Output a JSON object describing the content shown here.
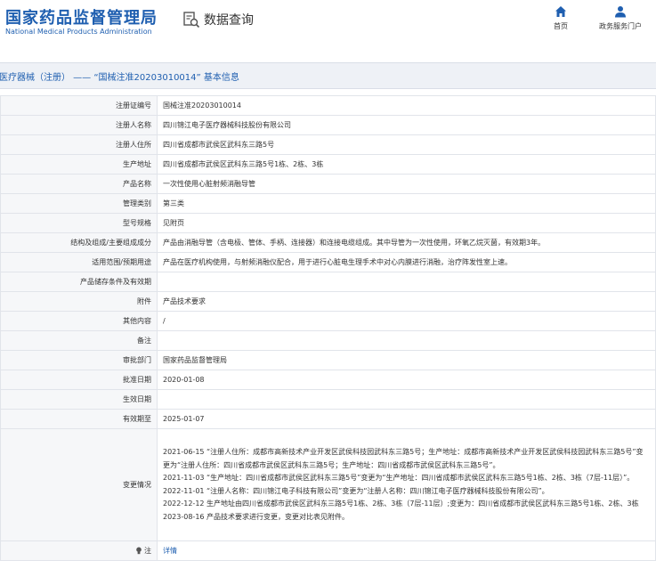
{
  "header": {
    "logo_cn": "国家药品监督管理局",
    "logo_en": "National Medical Products Administration",
    "data_query": "数据查询",
    "nav": [
      {
        "label": "首页",
        "icon": "home-icon"
      },
      {
        "label": "政务服务门户",
        "icon": "user-icon"
      }
    ]
  },
  "title": "医疗器械（注册） —— “国械注准20203010014” 基本信息",
  "rows": [
    {
      "label": "注册证编号",
      "value": "国械注准20203010014"
    },
    {
      "label": "注册人名称",
      "value": "四川锦江电子医疗器械科技股份有限公司"
    },
    {
      "label": "注册人住所",
      "value": "四川省成都市武侯区武科东三路5号"
    },
    {
      "label": "生产地址",
      "value": "四川省成都市武侯区武科东三路5号1栋、2栋、3栋"
    },
    {
      "label": "产品名称",
      "value": "一次性使用心脏射频消融导管"
    },
    {
      "label": "管理类别",
      "value": "第三类"
    },
    {
      "label": "型号规格",
      "value": "见附页"
    },
    {
      "label": "结构及组成/主要组成成分",
      "value": "产品由消融导管（含电极、管体、手柄、连接器）和连接电缆组成。其中导管为一次性使用，环氧乙烷灭菌，有效期3年。"
    },
    {
      "label": "适用范围/预期用途",
      "value": "产品在医疗机构使用，与射频消融仪配合，用于进行心脏电生理手术中对心内膜进行消融，治疗阵发性室上速。"
    },
    {
      "label": "产品储存条件及有效期",
      "value": ""
    },
    {
      "label": "附件",
      "value": "产品技术要求"
    },
    {
      "label": "其他内容",
      "value": "/"
    },
    {
      "label": "备注",
      "value": ""
    },
    {
      "label": "审批部门",
      "value": "国家药品监督管理局"
    },
    {
      "label": "批准日期",
      "value": "2020-01-08"
    },
    {
      "label": "生效日期",
      "value": ""
    },
    {
      "label": "有效期至",
      "value": "2025-01-07"
    }
  ],
  "changes": {
    "label": "变更情况",
    "items": [
      "2021-06-15 “注册人住所：成都市高新技术产业开发区武侯科技园武科东三路5号；生产地址：成都市高新技术产业开发区武侯科技园武科东三路5号”变更为“注册人住所：四川省成都市武侯区武科东三路5号；生产地址：四川省成都市武侯区武科东三路5号”。",
      "2021-11-03 “生产地址：四川省成都市武侯区武科东三路5号”变更为“生产地址：四川省成都市武侯区武科东三路5号1栋、2栋、3栋（7层-11层）”。",
      "2022-11-01 “注册人名称：四川锦江电子科技有限公司”变更为“注册人名称：四川锦江电子医疗器械科技股份有限公司”。",
      "2022-12-12 生产地址由四川省成都市武侯区武科东三路5号1栋、2栋、3栋（7层-11层）;变更为：四川省成都市武侯区武科东三路5号1栋、2栋、3栋",
      "2023-08-16 产品技术要求进行变更，变更对比表见附件。"
    ]
  },
  "hint": {
    "label": "注",
    "link": "详情"
  }
}
